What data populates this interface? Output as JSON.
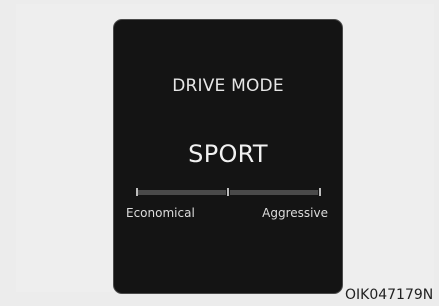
{
  "display": {
    "title": "DRIVE MODE",
    "mode": "SPORT",
    "gauge": {
      "left_label": "Economical",
      "right_label": "Aggressive"
    }
  },
  "caption": "OIK047179N"
}
